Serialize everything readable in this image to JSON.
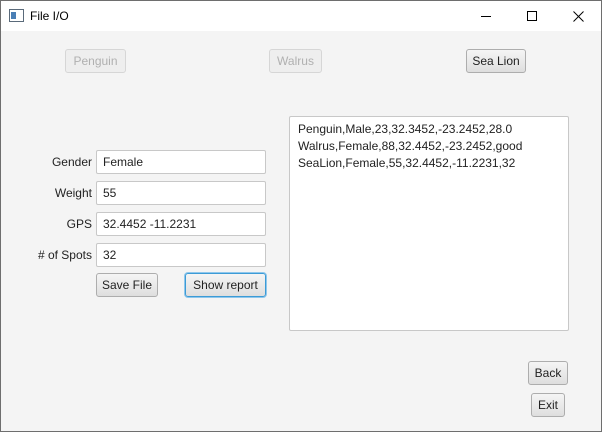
{
  "window": {
    "title": "File I/O"
  },
  "animal_buttons": {
    "penguin": "Penguin",
    "walrus": "Walrus",
    "sea_lion": "Sea Lion"
  },
  "form": {
    "gender_label": "Gender",
    "gender_value": "Female",
    "weight_label": "Weight",
    "weight_value": "55",
    "gps_label": "GPS",
    "gps_value": "32.4452 -11.2231",
    "spots_label": "# of Spots",
    "spots_value": "32",
    "save_label": "Save File",
    "report_label": "Show report"
  },
  "report": {
    "lines": [
      "Penguin,Male,23,32.3452,-23.2452,28.0",
      "Walrus,Female,88,32.4452,-23.2452,good",
      "SeaLion,Female,55,32.4452,-11.2231,32"
    ]
  },
  "nav": {
    "back_label": "Back",
    "exit_label": "Exit"
  },
  "icons": {
    "app": "app-window-icon",
    "minimize": "minimize-icon",
    "maximize": "maximize-icon",
    "close": "close-icon"
  }
}
